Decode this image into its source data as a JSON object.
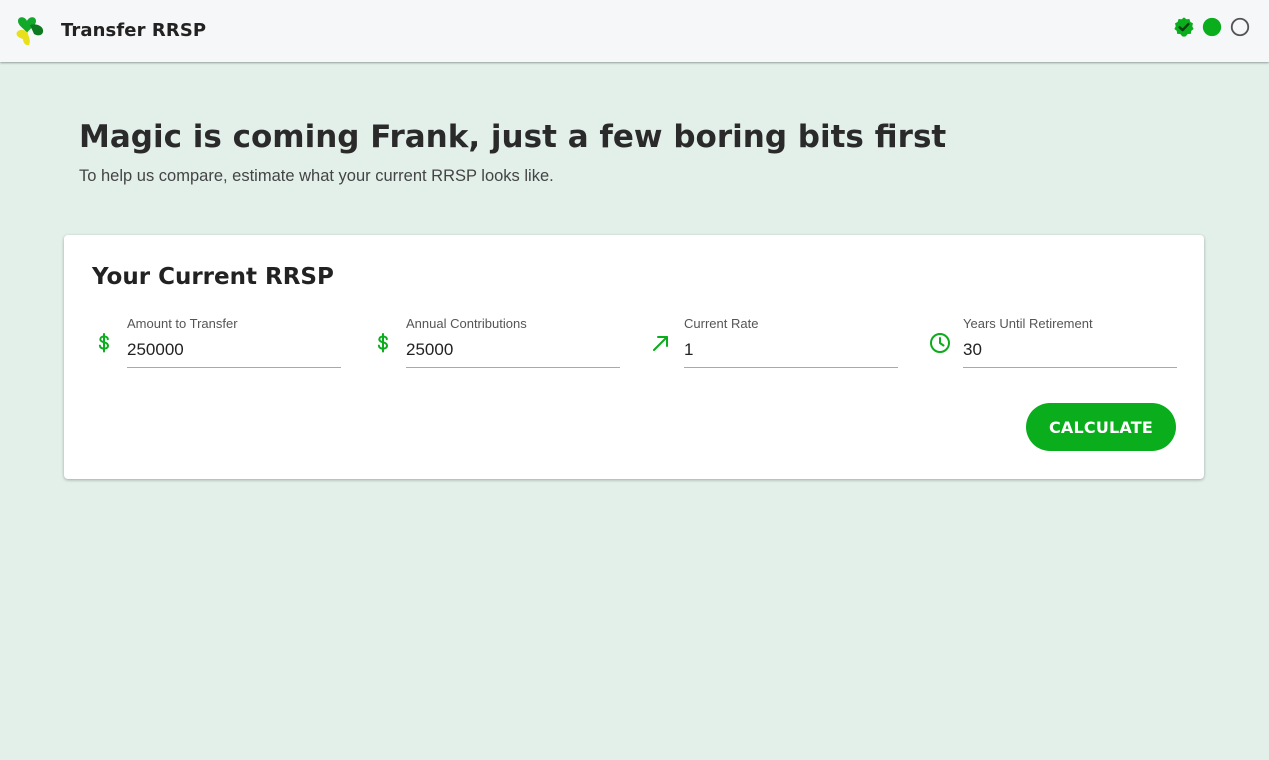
{
  "header": {
    "app_title": "Transfer RRSP",
    "logo_icon": "clover-logo-icon",
    "steps": [
      {
        "name": "step-1",
        "state": "completed",
        "icon": "check-badge-icon"
      },
      {
        "name": "step-2",
        "state": "current",
        "icon": "filled-circle-icon"
      },
      {
        "name": "step-3",
        "state": "pending",
        "icon": "empty-circle-icon"
      }
    ]
  },
  "intro": {
    "headline": "Magic is coming Frank, just a few boring bits first",
    "subline": "To help us compare, estimate what your current RRSP looks like."
  },
  "card": {
    "title": "Your Current RRSP",
    "fields": [
      {
        "label": "Amount to Transfer",
        "value": "250000",
        "icon": "dollar-icon"
      },
      {
        "label": "Annual Contributions",
        "value": "25000",
        "icon": "dollar-icon"
      },
      {
        "label": "Current Rate",
        "value": "1",
        "icon": "trending-up-arrow-icon"
      },
      {
        "label": "Years Until Retirement",
        "value": "30",
        "icon": "clock-icon"
      }
    ],
    "calculate_label": "CALCULATE"
  },
  "colors": {
    "accent": "#0aad1c",
    "background": "#e3f0ea",
    "header_bg": "#f6f7f9",
    "logo_green": "#12a82a",
    "logo_yellow": "#e7e01b"
  }
}
